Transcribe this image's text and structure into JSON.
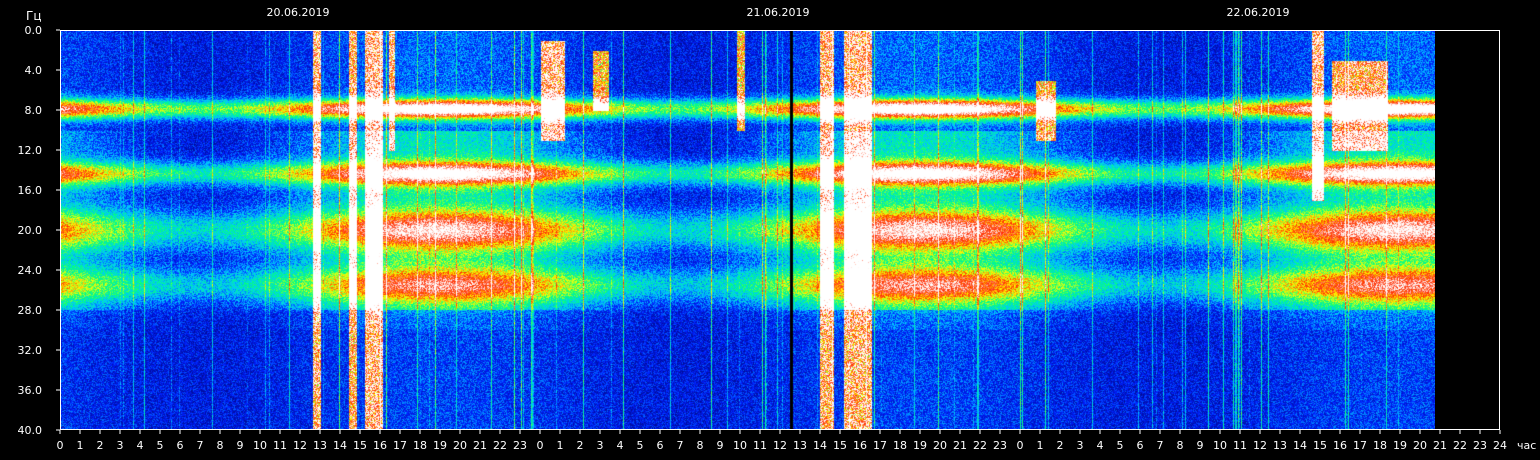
{
  "chart_data": {
    "type": "heatmap",
    "title": "",
    "ylabel": "Гц",
    "xlabel": "час",
    "ylim": [
      0,
      40
    ],
    "y_ticks": [
      "0.0",
      "4.0",
      "8.0",
      "12.0",
      "16.0",
      "20.0",
      "24.0",
      "28.0",
      "32.0",
      "36.0",
      "40.0"
    ],
    "x_ticks": [
      "0",
      "1",
      "2",
      "3",
      "4",
      "5",
      "6",
      "7",
      "8",
      "9",
      "10",
      "11",
      "12",
      "13",
      "14",
      "15",
      "16",
      "17",
      "18",
      "19",
      "20",
      "21",
      "22",
      "23",
      "0",
      "1",
      "2",
      "3",
      "4",
      "5",
      "6",
      "7",
      "8",
      "9",
      "10",
      "11",
      "12",
      "13",
      "14",
      "15",
      "16",
      "17",
      "18",
      "19",
      "20",
      "21",
      "22",
      "23",
      "0",
      "1",
      "2",
      "3",
      "4",
      "5",
      "6",
      "7",
      "8",
      "9",
      "10",
      "11",
      "12",
      "13",
      "14",
      "15",
      "16",
      "17",
      "18",
      "19",
      "20",
      "21",
      "22",
      "23",
      "24"
    ],
    "xlim_hours": [
      0,
      72
    ],
    "data_end_hour": 68.8,
    "dates": [
      {
        "label": "20.06.2019",
        "hour": 12
      },
      {
        "label": "21.06.2019",
        "hour": 36
      },
      {
        "label": "22.06.2019",
        "hour": 60
      }
    ],
    "colorscale": [
      "#000a8c",
      "#0020ff",
      "#00c8ff",
      "#00ff80",
      "#ffff00",
      "#ff2a00",
      "#ffffff"
    ],
    "bands": [
      {
        "freq_hz": 7.8,
        "intensity": 0.95,
        "width_hz": 1.0
      },
      {
        "freq_hz": 14.3,
        "intensity": 0.72,
        "width_hz": 1.2
      },
      {
        "freq_hz": 20.0,
        "intensity": 0.6,
        "width_hz": 2.0
      },
      {
        "freq_hz": 25.5,
        "intensity": 0.52,
        "width_hz": 1.8
      }
    ],
    "bursts": [
      {
        "start_hour": 12.6,
        "end_hour": 13.0,
        "freq_range": [
          0,
          40
        ],
        "intensity": 1.0
      },
      {
        "start_hour": 14.4,
        "end_hour": 14.8,
        "freq_range": [
          0,
          40
        ],
        "intensity": 0.9
      },
      {
        "start_hour": 15.2,
        "end_hour": 16.1,
        "freq_range": [
          0,
          40
        ],
        "intensity": 1.0
      },
      {
        "start_hour": 16.4,
        "end_hour": 16.7,
        "freq_range": [
          0,
          12
        ],
        "intensity": 0.9
      },
      {
        "start_hour": 24.0,
        "end_hour": 25.2,
        "freq_range": [
          1,
          11
        ],
        "intensity": 1.0
      },
      {
        "start_hour": 26.6,
        "end_hour": 27.4,
        "freq_range": [
          2,
          8
        ],
        "intensity": 0.85
      },
      {
        "start_hour": 33.8,
        "end_hour": 34.2,
        "freq_range": [
          0,
          10
        ],
        "intensity": 0.85
      },
      {
        "start_hour": 38.0,
        "end_hour": 38.7,
        "freq_range": [
          0,
          40
        ],
        "intensity": 0.95
      },
      {
        "start_hour": 39.2,
        "end_hour": 40.6,
        "freq_range": [
          0,
          40
        ],
        "intensity": 0.95
      },
      {
        "start_hour": 48.8,
        "end_hour": 49.8,
        "freq_range": [
          5,
          11
        ],
        "intensity": 0.8
      },
      {
        "start_hour": 62.6,
        "end_hour": 63.2,
        "freq_range": [
          0,
          17
        ],
        "intensity": 1.0
      },
      {
        "start_hour": 63.6,
        "end_hour": 66.4,
        "freq_range": [
          3,
          12
        ],
        "intensity": 0.85
      }
    ],
    "dropouts": [
      {
        "start_hour": 36.5,
        "end_hour": 36.65
      }
    ],
    "grid": false
  }
}
